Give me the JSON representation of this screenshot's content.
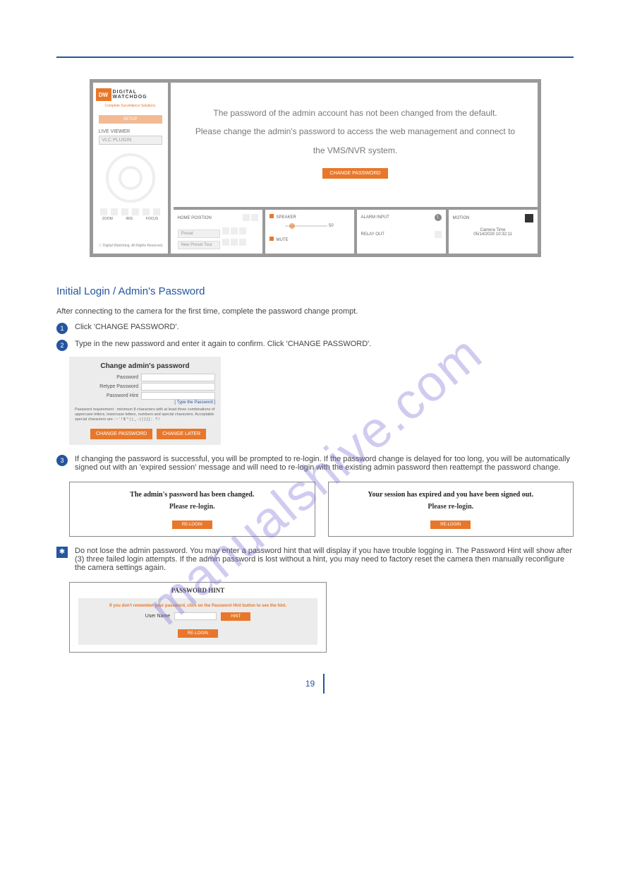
{
  "watermark": "manualshive.com",
  "shot1": {
    "logo_abbrev": "DW",
    "logo_line1": "DIGITAL",
    "logo_line2": "WATCHDOG",
    "logo_sub": "Complete Surveillance Solutions",
    "setup_label": "SETUP",
    "live_viewer_label": "LIVE VIEWER",
    "plugin_label": "VLC PLUGIN",
    "zoom": "ZOOM",
    "iris": "IRIS",
    "focus": "FOCUS",
    "copyright": "ⓒ Digital Watchdog. All Rights Reserved.",
    "msg1": "The password of the admin account has not been changed from the default.",
    "msg2": "Please change the admin's password to access the web management and connect to",
    "msg3": "the VMS/NVR system.",
    "change_btn": "CHANGE PASSWORD",
    "home_pos": "HOME POSITION",
    "preset": "Preset",
    "new_preset": "New Preset Tour",
    "speaker": "SPEAKER",
    "speaker_val": "50",
    "mute": "MUTE",
    "alarm_input": "ALARM INPUT",
    "alarm_badge": "1",
    "relay_out": "RELAY OUT",
    "motion": "MOTION",
    "cam_time_label": "Camera Time",
    "cam_time": "05/14/2020 10:32:11"
  },
  "section_title": "Initial Login / Admin's Password",
  "intro": "After connecting to the camera for the first time, complete the password change prompt.",
  "steps": {
    "s1": "Click 'CHANGE PASSWORD'.",
    "s2": "Type in the new password and enter it again to confirm. Click 'CHANGE PASSWORD'.",
    "s3": "If changing the password is successful, you will be prompted to re-login. If the password change is delayed for too long, you will be automatically signed out with an 'expired session' message and will need to re-login with the existing admin password then reattempt the password change."
  },
  "note": "Do not lose the admin password. You may enter a password hint that will display if you have trouble logging in. The Password Hint will show after (3) three failed login attempts. If the admin password is lost without a hint, you may need to factory reset the camera then manually reconfigure the camera settings again.",
  "dlg": {
    "title": "Change admin's password",
    "password": "Password",
    "retype": "Retype Password",
    "hint": "Password Hint",
    "hint_link": "[ Type the Password ]",
    "req": "Password requirement : minimum 8 characters with at least three combinations of uppercase letters, lowercase letters, numbers and special characters. Acceptable special characters are : ~ ' ! $ ^ ( ) _ - | { } [ ] ; . ? /",
    "btn1": "CHANGE PASSWORD",
    "btn2": "CHANGE LATER"
  },
  "rebox1": {
    "t1": "The admin's password has been changed.",
    "t2": "Please re-login.",
    "btn": "RE-LOGIN"
  },
  "rebox2": {
    "t1": "Your session has expired and you have been signed out.",
    "t2": "Please re-login.",
    "btn": "RE-LOGIN"
  },
  "hintbox": {
    "title": "PASSWORD HINT",
    "warn": "If you don't remember your password, click on the Password Hint button to see the hint.",
    "user": "User Name",
    "hint_btn": "HINT",
    "relogin": "RE-LOGIN"
  },
  "page_number": "19"
}
